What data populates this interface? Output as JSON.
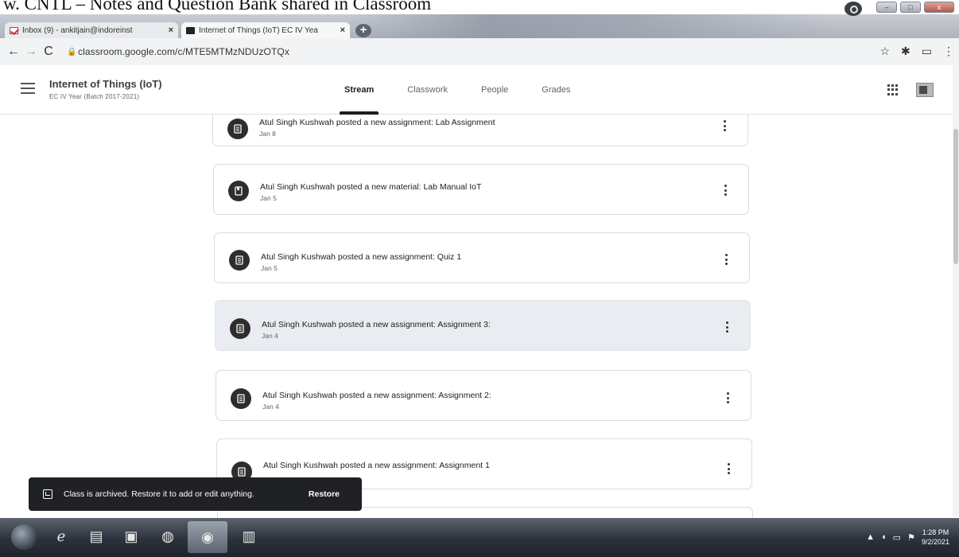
{
  "document_caption": "w.  CNTL – Notes and Question Bank shared in Classroom",
  "browser": {
    "tabs": [
      {
        "label": "Inbox (9) - ankitjain@indoreinst",
        "icon": "gmail-icon",
        "close": "×"
      },
      {
        "label": "Internet of Things (IoT) EC IV Yea",
        "icon": "classroom-icon",
        "close": "×"
      }
    ],
    "new_tab": "+",
    "url": "classroom.google.com/c/MTE5MTMzNDUzOTQx"
  },
  "header": {
    "class_title": "Internet of Things (IoT)",
    "class_subtitle": "EC IV Year (Batch 2017-2021)",
    "tabs": [
      {
        "label": "Stream",
        "active": true
      },
      {
        "label": "Classwork",
        "active": false
      },
      {
        "label": "People",
        "active": false
      },
      {
        "label": "Grades",
        "active": false
      }
    ]
  },
  "stream": {
    "posts": [
      {
        "text": "Atul Singh Kushwah posted a new assignment: Lab Assignment",
        "date": "Jan 8",
        "kind": "assignment",
        "highlighted": false
      },
      {
        "text": "Atul Singh Kushwah posted a new material: Lab Manual IoT",
        "date": "Jan 5",
        "kind": "material",
        "highlighted": false
      },
      {
        "text": "Atul Singh Kushwah posted a new assignment: Quiz 1",
        "date": "Jan 5",
        "kind": "assignment",
        "highlighted": false
      },
      {
        "text": "Atul Singh Kushwah posted a new assignment: Assignment 3:",
        "date": "Jan 4",
        "kind": "assignment",
        "highlighted": true
      },
      {
        "text": "Atul Singh Kushwah posted a new assignment: Assignment 2:",
        "date": "Jan 4",
        "kind": "assignment",
        "highlighted": false
      },
      {
        "text": "Atul Singh Kushwah posted a new assignment: Assignment 1",
        "date": "",
        "kind": "assignment",
        "highlighted": false
      }
    ]
  },
  "snackbar": {
    "message": "Class is archived. Restore it to add or edit anything.",
    "action": "Restore"
  },
  "taskbar": {
    "time": "1:28 PM",
    "date": "9/2/2021"
  }
}
